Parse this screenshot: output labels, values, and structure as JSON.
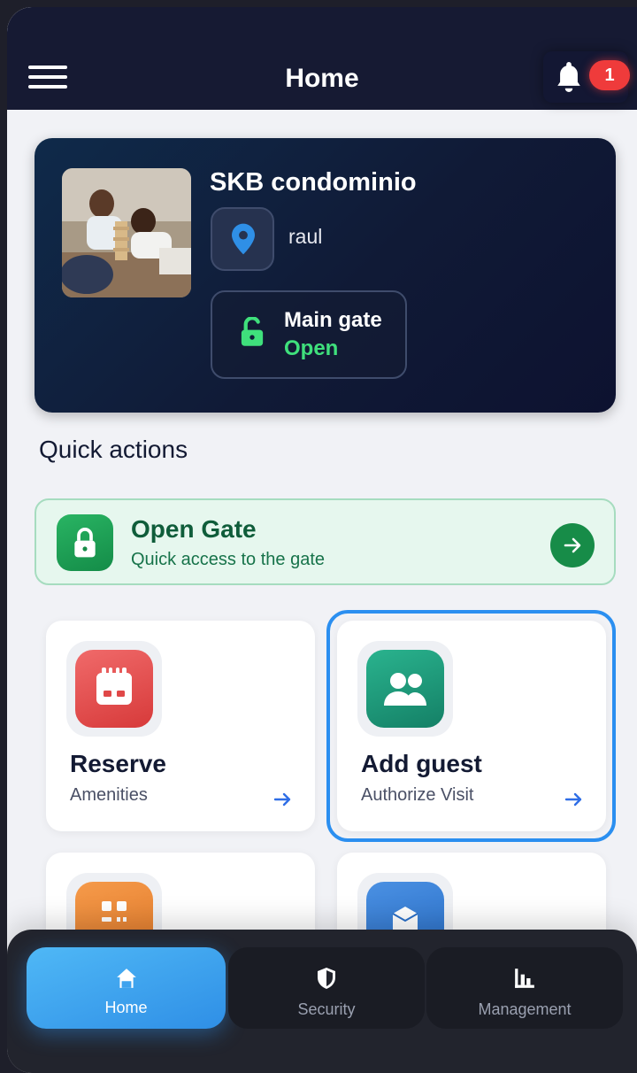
{
  "header": {
    "title": "Home",
    "notification_count": "1"
  },
  "hero": {
    "condo_name": "SKB condominio",
    "location": "raul",
    "gate_label": "Main gate",
    "gate_status": "Open"
  },
  "quick_actions": {
    "title": "Quick actions",
    "open_gate": {
      "title": "Open Gate",
      "subtitle": "Quick access to the gate"
    },
    "tiles": [
      {
        "title": "Reserve",
        "subtitle": "Amenities",
        "icon": "calendar-icon",
        "color": "#e84b4b"
      },
      {
        "title": "Add guest",
        "subtitle": "Authorize Visit",
        "icon": "users-icon",
        "color": "#1e9f7c"
      },
      {
        "title": "",
        "subtitle": "",
        "icon": "grid-icon",
        "color": "#f08a3a"
      },
      {
        "title": "",
        "subtitle": "",
        "icon": "package-icon",
        "color": "#2f7bd8"
      }
    ]
  },
  "bottom_nav": {
    "items": [
      {
        "label": "Home",
        "icon": "home-icon",
        "active": true
      },
      {
        "label": "Security",
        "icon": "shield-icon",
        "active": false
      },
      {
        "label": "Management",
        "icon": "bar-chart-icon",
        "active": false
      }
    ]
  },
  "colors": {
    "header_bg": "#161a33",
    "accent_green": "#178c48",
    "accent_blue": "#2b8ff0",
    "badge_red": "#ef3b3b"
  }
}
